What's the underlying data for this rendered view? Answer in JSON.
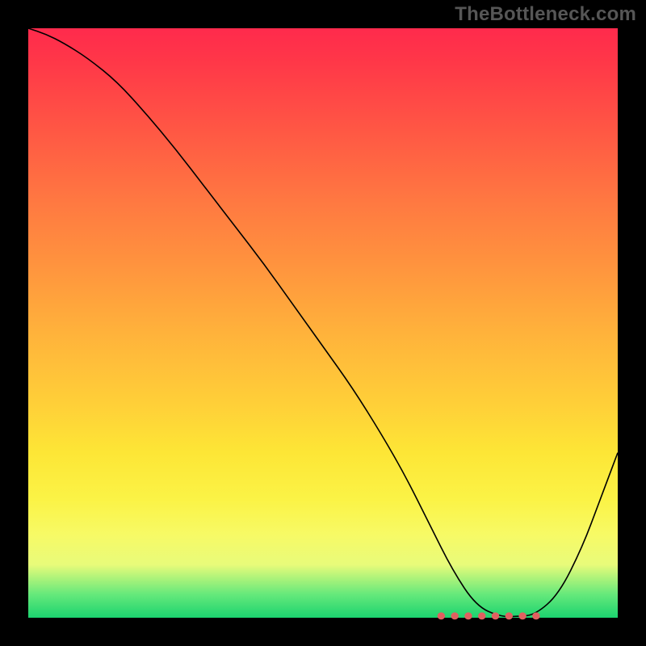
{
  "watermark": "TheBottleneck.com",
  "colors": {
    "curve_stroke": "#000000",
    "marker_stroke": "#e06060",
    "background": "#000000",
    "watermark": "#565656"
  },
  "chart_data": {
    "type": "line",
    "title": "",
    "xlabel": "",
    "ylabel": "",
    "xlim": [
      0,
      100
    ],
    "ylim": [
      0,
      100
    ],
    "grid": false,
    "legend": false,
    "series": [
      {
        "name": "bottleneck_curve",
        "x": [
          0,
          3,
          6,
          10,
          15,
          20,
          25,
          30,
          35,
          40,
          45,
          50,
          55,
          60,
          64,
          68,
          72,
          76,
          80,
          83,
          86,
          90,
          94,
          97,
          100
        ],
        "y": [
          100,
          99,
          97.5,
          95,
          91,
          85.5,
          79.5,
          73,
          66.5,
          60,
          53,
          46,
          39,
          31,
          24,
          16,
          8,
          2,
          0.2,
          0.2,
          0.5,
          4,
          12,
          20,
          28
        ]
      }
    ],
    "markers": {
      "name": "optimal_region_dashes",
      "x_range": [
        70,
        87
      ],
      "y_approx": 0.3,
      "style": "dashed-pink"
    },
    "background_gradient": [
      {
        "stop": 0.0,
        "color": "#ff2a4c"
      },
      {
        "stop": 0.3,
        "color": "#ff7a41"
      },
      {
        "stop": 0.64,
        "color": "#ffd038"
      },
      {
        "stop": 0.86,
        "color": "#f7fa66"
      },
      {
        "stop": 0.96,
        "color": "#66e97b"
      },
      {
        "stop": 1.0,
        "color": "#1bd36f"
      }
    ]
  }
}
